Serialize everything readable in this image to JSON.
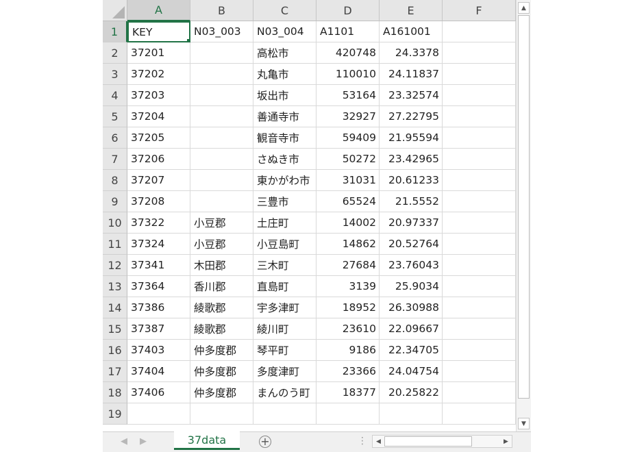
{
  "columns": [
    "A",
    "B",
    "C",
    "D",
    "E",
    "F"
  ],
  "row_numbers": [
    "1",
    "2",
    "3",
    "4",
    "5",
    "6",
    "7",
    "8",
    "9",
    "10",
    "11",
    "12",
    "13",
    "14",
    "15",
    "16",
    "17",
    "18",
    "19"
  ],
  "rows": [
    [
      "KEY",
      "N03_003",
      "N03_004",
      "A1101",
      "A161001",
      ""
    ],
    [
      "37201",
      "",
      "高松市",
      "420748",
      "24.3378",
      ""
    ],
    [
      "37202",
      "",
      "丸亀市",
      "110010",
      "24.11837",
      ""
    ],
    [
      "37203",
      "",
      "坂出市",
      "53164",
      "23.32574",
      ""
    ],
    [
      "37204",
      "",
      "善通寺市",
      "32927",
      "27.22795",
      ""
    ],
    [
      "37205",
      "",
      "観音寺市",
      "59409",
      "21.95594",
      ""
    ],
    [
      "37206",
      "",
      "さぬき市",
      "50272",
      "23.42965",
      ""
    ],
    [
      "37207",
      "",
      "東かがわ市",
      "31031",
      "20.61233",
      ""
    ],
    [
      "37208",
      "",
      "三豊市",
      "65524",
      "21.5552",
      ""
    ],
    [
      "37322",
      "小豆郡",
      "土庄町",
      "14002",
      "20.97337",
      ""
    ],
    [
      "37324",
      "小豆郡",
      "小豆島町",
      "14862",
      "20.52764",
      ""
    ],
    [
      "37341",
      "木田郡",
      "三木町",
      "27684",
      "23.76043",
      ""
    ],
    [
      "37364",
      "香川郡",
      "直島町",
      "3139",
      "25.9034",
      ""
    ],
    [
      "37386",
      "綾歌郡",
      "宇多津町",
      "18952",
      "26.30988",
      ""
    ],
    [
      "37387",
      "綾歌郡",
      "綾川町",
      "23610",
      "22.09667",
      ""
    ],
    [
      "37403",
      "仲多度郡",
      "琴平町",
      "9186",
      "22.34705",
      ""
    ],
    [
      "37404",
      "仲多度郡",
      "多度津町",
      "23366",
      "24.04754",
      ""
    ],
    [
      "37406",
      "仲多度郡",
      "まんのう町",
      "18377",
      "20.25822",
      ""
    ],
    [
      "",
      "",
      "",
      "",
      "",
      ""
    ]
  ],
  "numeric_columns": [
    "D",
    "E"
  ],
  "active_cell": "A1",
  "sheet_tab": "37data",
  "icons": {
    "select_all": "select-all-triangle-icon",
    "scroll_up": "chevron-up-icon",
    "scroll_down": "chevron-down-icon",
    "scroll_left": "chevron-left-icon",
    "scroll_right": "chevron-right-icon",
    "new_sheet": "plus-circle-icon"
  },
  "glyphs": {
    "up": "▲",
    "down": "▼",
    "left": "◀",
    "right": "▶",
    "prev": "◀",
    "next": "▶",
    "plus": "+",
    "splitter": "⋮"
  },
  "colors": {
    "accent": "#217346",
    "header_bg": "#e6e6e6",
    "selected_header_bg": "#d2d2d2",
    "grid_line": "#d9d9d9"
  }
}
